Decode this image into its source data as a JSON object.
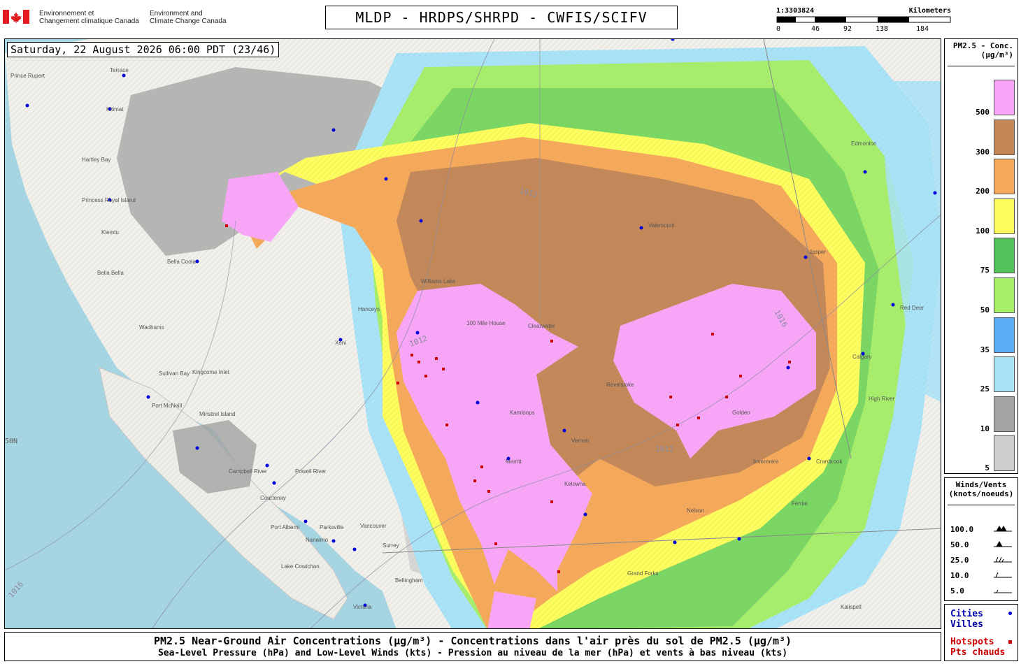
{
  "agency": {
    "french": "Environnement et\nChangement climatique Canada",
    "english": "Environment and\nClimate Change Canada"
  },
  "header": {
    "title": "MLDP - HRDPS/SHRPD - CWFIS/SCIFV"
  },
  "scale_bar": {
    "ratio": "1:3303824",
    "unit": "Kilometers",
    "ticks": [
      "0",
      "46",
      "92",
      "138",
      "184"
    ]
  },
  "timestamp": "Saturday, 22 August 2026 06:00 PDT (23/46)",
  "legend": {
    "title": "PM2.5 - Conc.\n(µg/m³)",
    "items": [
      {
        "label": "500",
        "color": "#f9a6f9"
      },
      {
        "label": "300",
        "color": "#c48858"
      },
      {
        "label": "200",
        "color": "#f7a95a"
      },
      {
        "label": "100",
        "color": "#fdfd5c"
      },
      {
        "label": "75",
        "color": "#53c25b"
      },
      {
        "label": "50",
        "color": "#a7ef6b"
      },
      {
        "label": "35",
        "color": "#5aaef7"
      },
      {
        "label": "25",
        "color": "#a8e3f8"
      },
      {
        "label": "10",
        "color": "#a3a3a3"
      },
      {
        "label": "5",
        "color": "#cfcfcf"
      }
    ]
  },
  "wind_legend": {
    "title": "Winds/Vents\n(knots/noeuds)",
    "rows": [
      "100.0",
      "50.0",
      "25.0",
      "10.0",
      "5.0"
    ]
  },
  "key": {
    "cities_en": "Cities",
    "cities_fr": "Villes",
    "hotspots_en": "Hotspots",
    "hotspots_fr": "Pts chauds",
    "city_color": "#0000dd",
    "hotspot_color": "#cc0000"
  },
  "caption": {
    "line1": "PM2.5 Near-Ground Air Concentrations (µg/m³) - Concentrations dans l'air près du sol de PM2.5 (µg/m³)",
    "line2": "Sea-Level Pressure (hPa) and Low-Level Winds (kts) - Pression au niveau de la mer (hPa) et vents à bas niveau (kts)"
  },
  "map": {
    "latitude_label": "50N",
    "isobar_labels": [
      "1012",
      "1016"
    ],
    "places": [
      "Prince Rupert",
      "Terrace",
      "Kitimat",
      "Hartley Bay",
      "Princess Royal Island",
      "Klemtu",
      "Bella Bella",
      "Bella Coola",
      "Wadhams",
      "Sullivan Bay",
      "Kingcome Inlet",
      "Port McNeill",
      "Minstrel Island",
      "Campbell River",
      "Powell River",
      "Courtenay",
      "Port Alberni",
      "Parksville",
      "Nanaimo",
      "Lake Cowichan",
      "Vancouver",
      "Surrey",
      "Bellingham",
      "Victoria",
      "Hanceys",
      "Xeni",
      "Williams Lake",
      "100 Mile House",
      "Clearwater",
      "Kamloops",
      "Merritt",
      "Vernon",
      "Kelowna",
      "Revelstoke",
      "Nelson",
      "Grand Forks",
      "Valemount",
      "Jasper",
      "Edmonton",
      "Calgary",
      "High River",
      "Red Deer",
      "Fernie",
      "Cranbrook",
      "Kalispell",
      "Golden",
      "Invermere"
    ]
  }
}
